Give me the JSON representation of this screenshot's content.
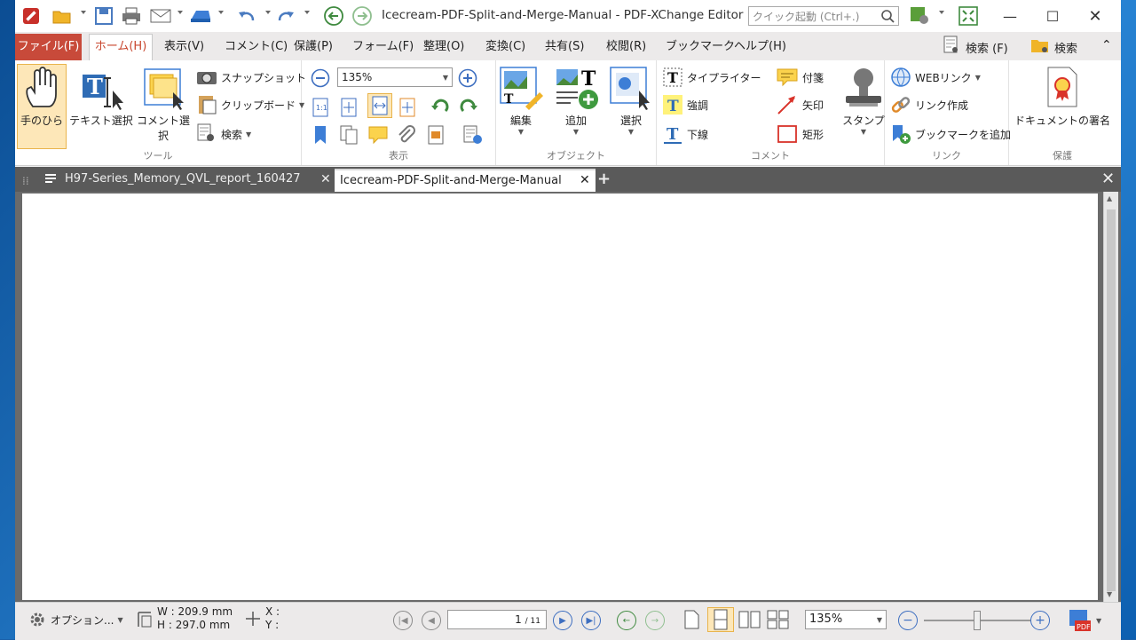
{
  "window": {
    "title": "Icecream-PDF-Split-and-Merge-Manual - PDF-XChange Editor",
    "quick_launch_placeholder": "クイック起動 (Ctrl+.)"
  },
  "menu": {
    "file": "ファイル(F)",
    "items": [
      "ホーム(H)",
      "表示(V)",
      "コメント(C)",
      "保護(P)",
      "フォーム(F)",
      "整理(O)",
      "変換(C)",
      "共有(S)",
      "校閲(R)",
      "ブックマーク",
      "ヘルプ(H)"
    ],
    "search1": "検索 (F)",
    "search2": "検索"
  },
  "ribbon": {
    "tools": {
      "label": "ツール",
      "hand": "手のひら",
      "text_select": "テキスト選択",
      "comment_select": "コメント選択",
      "snapshot": "スナップショット",
      "clipboard": "クリップボード",
      "search": "検索"
    },
    "view": {
      "label": "表示",
      "zoom": "135%"
    },
    "objects": {
      "label": "オブジェクト",
      "edit": "編集",
      "add": "追加",
      "select": "選択"
    },
    "comments": {
      "label": "コメント",
      "typewriter": "タイプライター",
      "note": "付箋",
      "highlight": "強調",
      "arrow": "矢印",
      "underline": "下線",
      "rectangle": "矩形",
      "stamp": "スタンプ"
    },
    "links": {
      "label": "リンク",
      "web": "WEBリンク",
      "create": "リンク作成",
      "bookmark": "ブックマークを追加"
    },
    "protect": {
      "label": "保護",
      "sign": "ドキュメントの署名"
    }
  },
  "tabs": [
    {
      "label": "H97-Series_Memory_QVL_report_160427",
      "active": false
    },
    {
      "label": "Icecream-PDF-Split-and-Merge-Manual",
      "active": true
    }
  ],
  "status": {
    "options": "オプション...",
    "width": "W : 209.9 mm",
    "height": "H : 297.0 mm",
    "x": "X :",
    "y": "Y :",
    "page_current": "1",
    "page_total": "/ 11",
    "zoom": "135%"
  },
  "colors": {
    "accent": "#c84a3a",
    "tab_bar": "#5a5a5a",
    "hand_active": "#fde7b8"
  }
}
